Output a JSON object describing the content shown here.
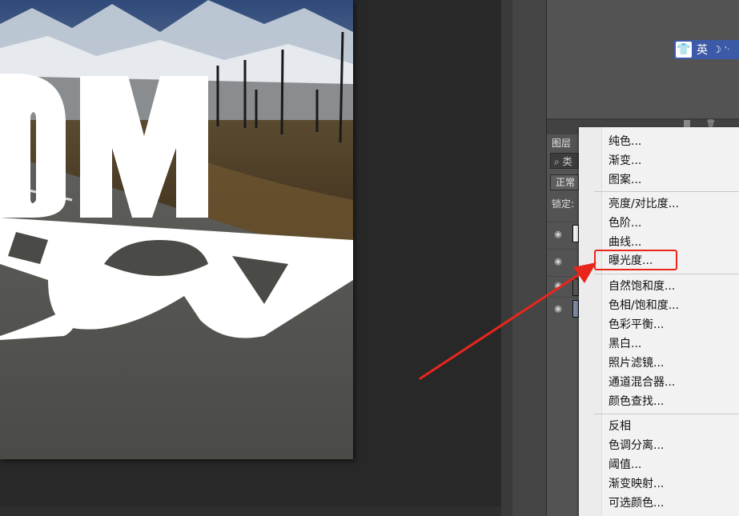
{
  "ime_indicator": {
    "label": "英"
  },
  "layers_panel": {
    "tab_label": "图层",
    "filter_label": "类",
    "blend_mode": "正常",
    "lock_label": "锁定:"
  },
  "context_menu": {
    "groups": [
      [
        "纯色...",
        "渐变...",
        "图案..."
      ],
      [
        "亮度/对比度...",
        "色阶...",
        "曲线...",
        "曝光度..."
      ],
      [
        "自然饱和度...",
        "色相/饱和度...",
        "色彩平衡...",
        "黑白...",
        "照片滤镜...",
        "通道混合器...",
        "颜色查找..."
      ],
      [
        "反相",
        "色调分离...",
        "阈值...",
        "渐变映射...",
        "可选颜色..."
      ]
    ],
    "highlighted_item": "曝光度...",
    "highlight_color": "#e8261c"
  },
  "canvas": {
    "headline_fragment": "OM"
  }
}
